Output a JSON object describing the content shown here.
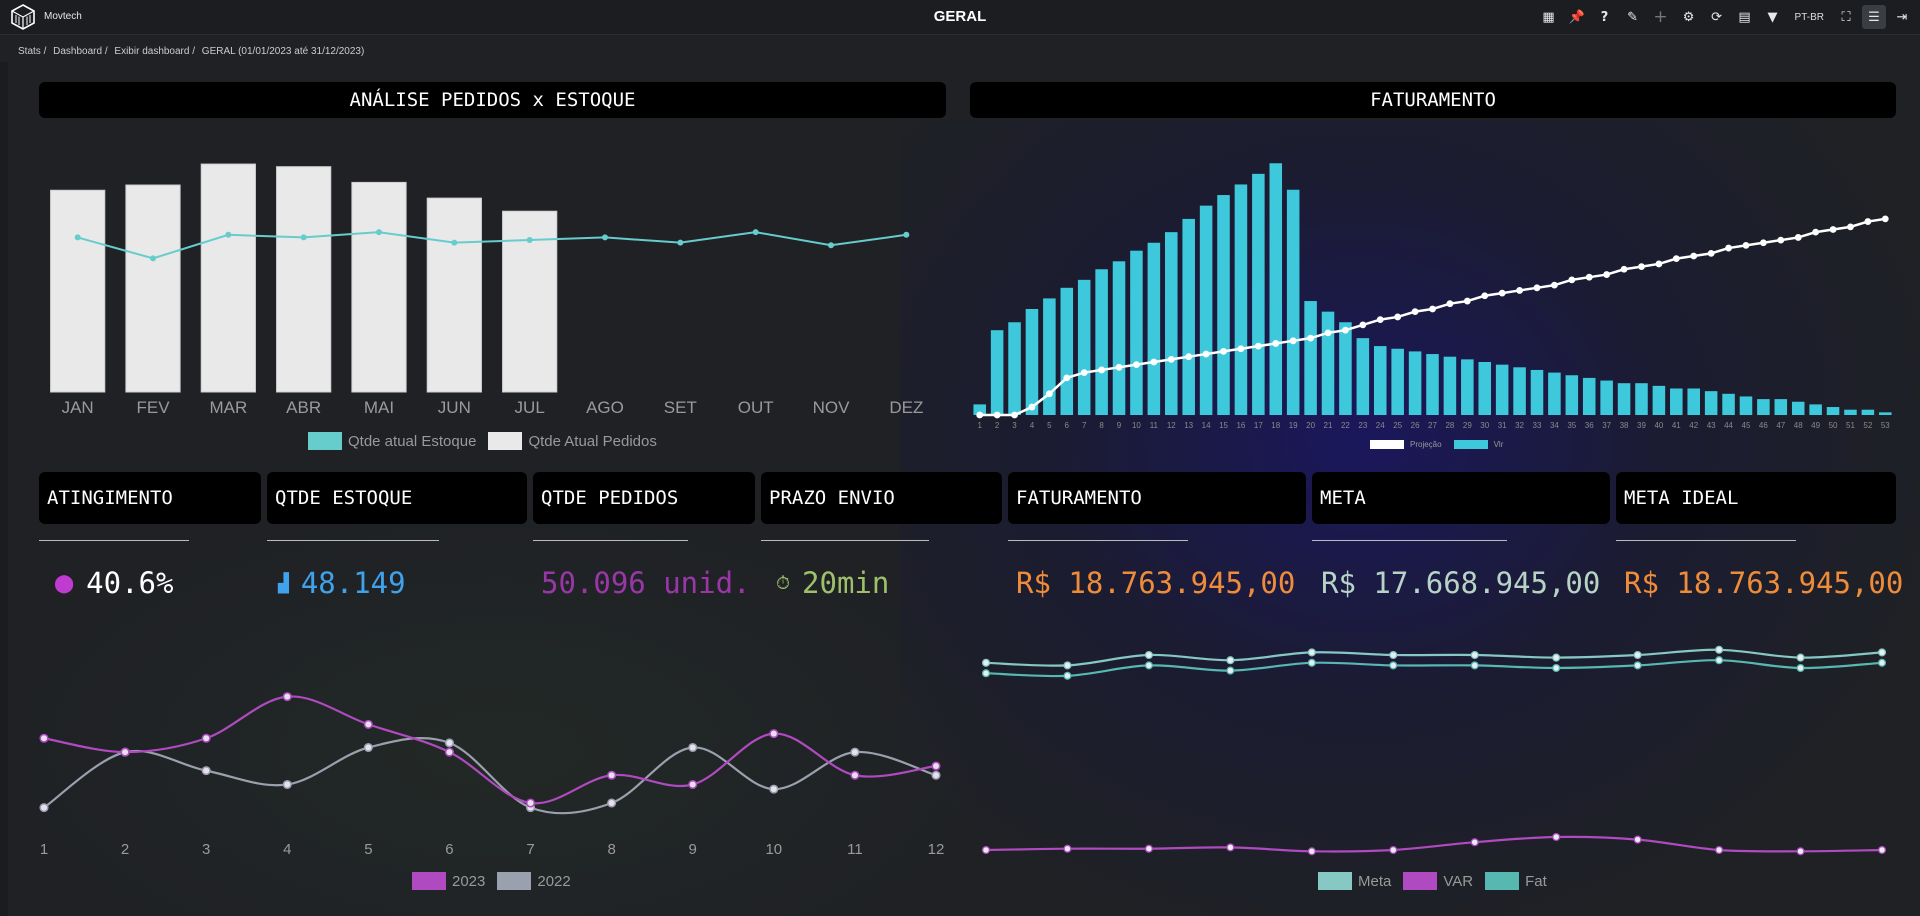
{
  "header": {
    "brand": "Movtech",
    "title": "GERAL",
    "lang": "PT-BR"
  },
  "toolbar": {
    "icons": [
      "grid-icon",
      "pin-icon",
      "help-icon",
      "pencil-icon",
      "plus-icon",
      "gear-icon",
      "refresh-icon",
      "calendar-icon",
      "filter-icon",
      "fullscreen-icon",
      "menu-icon",
      "logout-icon"
    ]
  },
  "breadcrumb": [
    "Stats /",
    "Dashboard /",
    "Exibir dashboard /",
    "GERAL (01/01/2023 até 31/12/2023)"
  ],
  "panels": {
    "left_title": "ANÁLISE PEDIDOS x ESTOQUE",
    "right_title": "FATURAMENTO"
  },
  "kpis": [
    {
      "label": "ATINGIMENTO",
      "value": "40.6%",
      "color": "#ffffff",
      "icon": "map-pin-icon",
      "icon_color": "#c03bd0"
    },
    {
      "label": "QTDE ESTOQUE",
      "value": "48.149",
      "color": "#3fa2ea",
      "icon": "boxes-icon",
      "icon_color": "#3fa2ea"
    },
    {
      "label": "QTDE PEDIDOS",
      "value": "50.096 unid.",
      "color": "#9a36a8",
      "icon": "",
      "icon_color": ""
    },
    {
      "label": "PRAZO ENVIO",
      "value": "20min",
      "color": "#9fc06a",
      "icon": "stopwatch-icon",
      "icon_color": "#9fc06a"
    },
    {
      "label": "FATURAMENTO",
      "value": "R$ 18.763.945,00",
      "color": "#ef8c3a",
      "icon": "",
      "icon_color": ""
    },
    {
      "label": "META",
      "value": "R$ 17.668.945,00",
      "color": "#b7d3c6",
      "icon": "",
      "icon_color": ""
    },
    {
      "label": "META IDEAL",
      "value": "R$ 18.763.945,00",
      "color": "#ef8c3a",
      "icon": "",
      "icon_color": ""
    }
  ],
  "chart_data": [
    {
      "type": "bar",
      "categories": [
        "JAN",
        "FEV",
        "MAR",
        "ABR",
        "MAI",
        "JUN",
        "JUL",
        "AGO",
        "SET",
        "OUT",
        "NOV",
        "DEZ"
      ],
      "series": [
        {
          "name": "Qtde atual Estoque",
          "kind": "line",
          "color": "#66cccc",
          "values": [
            59,
            51,
            60,
            59,
            61,
            57,
            58,
            59,
            57,
            61,
            56,
            60
          ]
        },
        {
          "name": "Qtde Atual Pedidos",
          "kind": "bar",
          "color": "#e9e9e9",
          "values": [
            77,
            79,
            87,
            86,
            80,
            74,
            69,
            null,
            null,
            null,
            null,
            null
          ]
        }
      ],
      "ylim": [
        0,
        100
      ],
      "legend": "bottom"
    },
    {
      "type": "bar",
      "categories": [
        "1",
        "2",
        "3",
        "4",
        "5",
        "6",
        "7",
        "8",
        "9",
        "10",
        "11",
        "12",
        "13",
        "14",
        "15",
        "16",
        "17",
        "18",
        "19",
        "20",
        "21",
        "22",
        "23",
        "24",
        "25",
        "26",
        "27",
        "28",
        "29",
        "30",
        "31",
        "32",
        "33",
        "34",
        "35",
        "36",
        "37",
        "38",
        "39",
        "40",
        "41",
        "42",
        "43",
        "44",
        "45",
        "46",
        "47",
        "48",
        "49",
        "50",
        "51",
        "52",
        "53"
      ],
      "series": [
        {
          "name": "Projeção",
          "kind": "line",
          "color": "#ffffff",
          "values": [
            0,
            0,
            0,
            3,
            8,
            14,
            16,
            17,
            18,
            19,
            20,
            21,
            22,
            23,
            24,
            25,
            26,
            27,
            28,
            29,
            31,
            32,
            34,
            36,
            37,
            39,
            40,
            42,
            43,
            45,
            46,
            47,
            48,
            49,
            51,
            52,
            53,
            55,
            56,
            57,
            59,
            60,
            61,
            63,
            64,
            65,
            66,
            67,
            69,
            70,
            71,
            73,
            74
          ]
        },
        {
          "name": "Vlr",
          "kind": "bar",
          "color": "#3ec8dc",
          "values": [
            4,
            32,
            35,
            40,
            44,
            48,
            51,
            55,
            58,
            62,
            65,
            69,
            74,
            79,
            83,
            87,
            91,
            95,
            85,
            43,
            39,
            35,
            29,
            26,
            25,
            24,
            23,
            22,
            21,
            20,
            19,
            18,
            17,
            16,
            15,
            14,
            13,
            12,
            12,
            11,
            10,
            10,
            9,
            8,
            7,
            6,
            6,
            5,
            4,
            3,
            2,
            2,
            1
          ]
        }
      ],
      "ylim": [
        0,
        100
      ],
      "legend": "bottom"
    },
    {
      "type": "line",
      "x": [
        1,
        2,
        3,
        4,
        5,
        6,
        7,
        8,
        9,
        10,
        11,
        12
      ],
      "series": [
        {
          "name": "2023",
          "color": "#b04ac0",
          "values": [
            67,
            64,
            67,
            76,
            70,
            64,
            53,
            59,
            57,
            68,
            59,
            61
          ]
        },
        {
          "name": "2022",
          "color": "#9aa0ad",
          "values": [
            52,
            64,
            60,
            57,
            65,
            66,
            52,
            53,
            65,
            56,
            64,
            59
          ]
        }
      ],
      "ylim": [
        45,
        85
      ],
      "legend": "bottom"
    },
    {
      "type": "line",
      "x": [
        1,
        2,
        3,
        4,
        5,
        6,
        7,
        8,
        9,
        10,
        11,
        12
      ],
      "series": [
        {
          "name": "Meta",
          "color": "#86c8c4",
          "values": [
            82,
            81,
            85,
            83,
            86,
            85,
            85,
            84,
            85,
            87,
            84,
            86
          ]
        },
        {
          "name": "VAR",
          "color": "#b04ac0",
          "values": [
            10,
            10.5,
            10.5,
            11,
            9.5,
            10,
            13,
            15,
            14,
            10,
            9.5,
            10
          ]
        },
        {
          "name": "Fat",
          "color": "#56b8b0",
          "values": [
            78,
            77,
            81,
            79,
            82,
            81,
            81,
            80,
            81,
            83,
            80,
            82
          ]
        }
      ],
      "ylim": [
        0,
        100
      ],
      "legend": "bottom"
    }
  ]
}
